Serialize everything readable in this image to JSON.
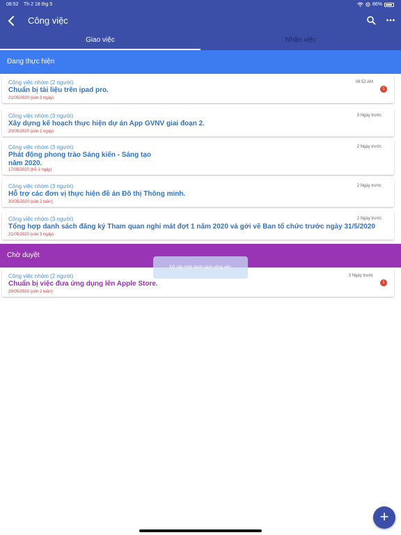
{
  "status_bar": {
    "time": "08:52",
    "date": "Th 2 18 thg 5",
    "battery": "86%"
  },
  "nav": {
    "title": "Công việc"
  },
  "tabs": [
    {
      "label": "Giao việc",
      "active": true
    },
    {
      "label": "Nhận việc",
      "active": false
    }
  ],
  "sections": {
    "in_progress": "Đang thực hiện",
    "pending": "Chờ duyệt"
  },
  "cards_in_progress": [
    {
      "category": "Công việc nhóm (2 người)",
      "title": "Chuẩn bị tài liệu trên ipad pro.",
      "due": "21/05/2020 (còn 3 ngày)",
      "time": "08:52 AM",
      "badge": "1"
    },
    {
      "category": "Công việc nhóm (3 người)",
      "title": "Xây dựng kế hoạch thực hiện dự án App GVNV giai đoạn 2.",
      "due": "20/05/2020 (còn 2 ngày)",
      "time": "3 Ngày trước"
    },
    {
      "category": "Công việc nhóm (3 người)",
      "title_line1": "Phát động phong trào Sáng kiến - Sáng tạo",
      "title_line2": "năm 2020.",
      "due": "17/05/2020 (trễ 1 ngày)",
      "time": "2 Ngày trước"
    },
    {
      "category": "Công việc nhóm (3 người)",
      "title": "Hỗ trợ các đơn vị thực hiện đề án Đô thị Thông minh.",
      "due": "30/05/2020 (còn 2 tuần)",
      "time": "2 Ngày trước"
    },
    {
      "category": "Công việc nhóm (3 người)",
      "title": "Tổng hợp danh sách đăng ký Tham quan nghỉ mát đợt 1 năm 2020 và gởi về Ban tổ chức trước ngày 31/5/2020",
      "due": "21/05/2020 (còn 3 ngày)",
      "time": "2 Ngày trước"
    }
  ],
  "cards_pending": [
    {
      "category": "Công việc nhóm (2 người)",
      "title": "Chuẩn bị việc đưa ứng dụng lên Apple Store.",
      "due": "29/05/2020 (còn 2 tuần)",
      "time": "3 Ngày trước",
      "badge": "1"
    }
  ],
  "toast": "Đã cập nhật danh sách công việc",
  "fab": "+",
  "colors": {
    "header": "#3b4ea8",
    "section_blue": "#3d7bf1",
    "section_purple": "#9935b4",
    "title_blue": "#2f73c9",
    "due_red": "#d23a3a",
    "badge_red": "#e2412c"
  }
}
